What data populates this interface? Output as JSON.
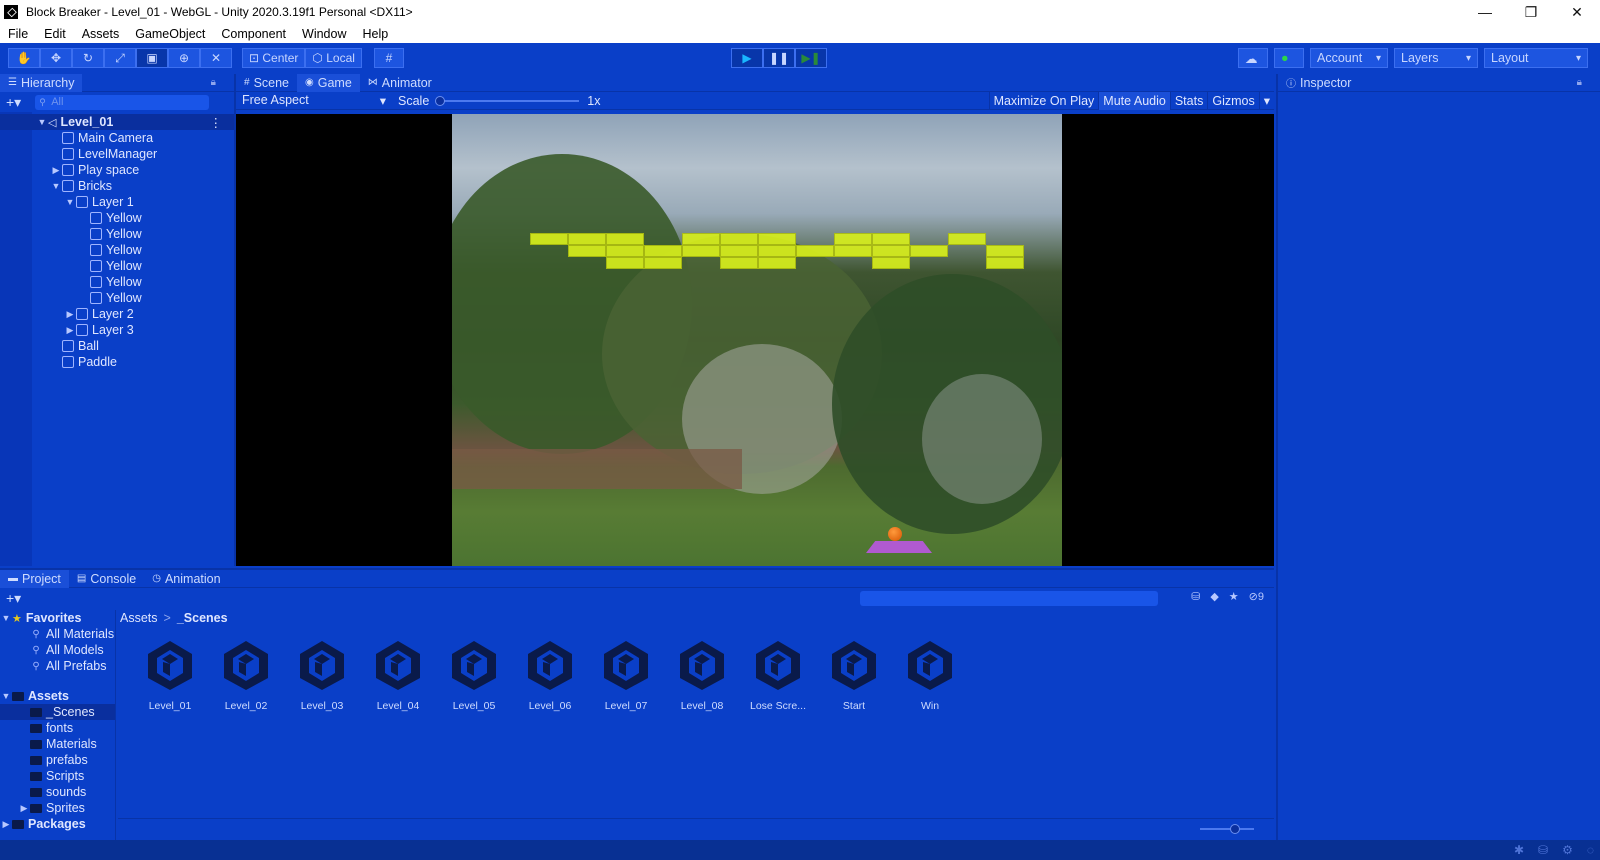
{
  "window": {
    "title": "Block Breaker - Level_01 - WebGL - Unity 2020.3.19f1 Personal <DX11>",
    "minimize": "—",
    "maximize": "❐",
    "close": "✕"
  },
  "menu": [
    "File",
    "Edit",
    "Assets",
    "GameObject",
    "Component",
    "Window",
    "Help"
  ],
  "toolbar": {
    "tools": [
      "hand-icon",
      "move-icon",
      "rotate-icon",
      "scale-icon",
      "rect-icon",
      "transform-icon",
      "custom-tool-icon"
    ],
    "center_label": "Center",
    "local_label": "Local",
    "account_label": "Account",
    "layers_label": "Layers",
    "layout_label": "Layout"
  },
  "hierarchy": {
    "tab": "Hierarchy",
    "search_placeholder": "All",
    "items": [
      {
        "label": "Level_01",
        "depth": 0,
        "expanded": "open",
        "kind": "scene"
      },
      {
        "label": "Main Camera",
        "depth": 1,
        "expanded": "none",
        "kind": "object"
      },
      {
        "label": "LevelManager",
        "depth": 1,
        "expanded": "none",
        "kind": "object"
      },
      {
        "label": "Play space",
        "depth": 1,
        "expanded": "closed",
        "kind": "object"
      },
      {
        "label": "Bricks",
        "depth": 1,
        "expanded": "open",
        "kind": "object"
      },
      {
        "label": "Layer 1",
        "depth": 2,
        "expanded": "open",
        "kind": "object"
      },
      {
        "label": "Yellow",
        "depth": 3,
        "expanded": "none",
        "kind": "object"
      },
      {
        "label": "Yellow",
        "depth": 3,
        "expanded": "none",
        "kind": "object"
      },
      {
        "label": "Yellow",
        "depth": 3,
        "expanded": "none",
        "kind": "object"
      },
      {
        "label": "Yellow",
        "depth": 3,
        "expanded": "none",
        "kind": "object"
      },
      {
        "label": "Yellow",
        "depth": 3,
        "expanded": "none",
        "kind": "object"
      },
      {
        "label": "Yellow",
        "depth": 3,
        "expanded": "none",
        "kind": "object"
      },
      {
        "label": "Layer 2",
        "depth": 2,
        "expanded": "closed",
        "kind": "object"
      },
      {
        "label": "Layer 3",
        "depth": 2,
        "expanded": "closed",
        "kind": "object"
      },
      {
        "label": "Ball",
        "depth": 1,
        "expanded": "none",
        "kind": "object"
      },
      {
        "label": "Paddle",
        "depth": 1,
        "expanded": "none",
        "kind": "object"
      }
    ]
  },
  "game": {
    "tabs": [
      {
        "label": "Scene",
        "icon": "grid-icon",
        "active": false
      },
      {
        "label": "Game",
        "icon": "gamepad-icon",
        "active": true
      },
      {
        "label": "Animator",
        "icon": "animator-icon",
        "active": false
      }
    ],
    "aspect": "Free Aspect",
    "scale_label": "Scale",
    "scale_value": "1x",
    "options": [
      {
        "label": "Maximize On Play",
        "on": false
      },
      {
        "label": "Mute Audio",
        "on": true
      },
      {
        "label": "Stats",
        "on": false
      },
      {
        "label": "Gizmos",
        "on": false
      }
    ]
  },
  "inspector": {
    "tab": "Inspector"
  },
  "project": {
    "tabs": [
      {
        "label": "Project",
        "icon": "folder-icon",
        "active": true
      },
      {
        "label": "Console",
        "icon": "console-icon",
        "active": false
      },
      {
        "label": "Animation",
        "icon": "animation-icon",
        "active": false
      }
    ],
    "hidden_count": "9",
    "favorites_label": "Favorites",
    "favorites": [
      "All Materials",
      "All Models",
      "All Prefabs"
    ],
    "assets_label": "Assets",
    "folders": [
      {
        "label": "_Scenes",
        "selected": true,
        "expandable": false
      },
      {
        "label": "fonts",
        "selected": false,
        "expandable": false
      },
      {
        "label": "Materials",
        "selected": false,
        "expandable": false
      },
      {
        "label": "prefabs",
        "selected": false,
        "expandable": false
      },
      {
        "label": "Scripts",
        "selected": false,
        "expandable": false
      },
      {
        "label": "sounds",
        "selected": false,
        "expandable": false
      },
      {
        "label": "Sprites",
        "selected": false,
        "expandable": true
      }
    ],
    "packages_label": "Packages",
    "breadcrumb": [
      "Assets",
      "_Scenes"
    ],
    "scenes": [
      "Level_01",
      "Level_02",
      "Level_03",
      "Level_04",
      "Level_05",
      "Level_06",
      "Level_07",
      "Level_08",
      "Lose Scre...",
      "Start",
      "Win"
    ]
  },
  "colors": {
    "theme": "#0a3fc8",
    "brick": "#d7ee1c",
    "paddle": "#b05ad0",
    "ball": "#f07a1a"
  }
}
